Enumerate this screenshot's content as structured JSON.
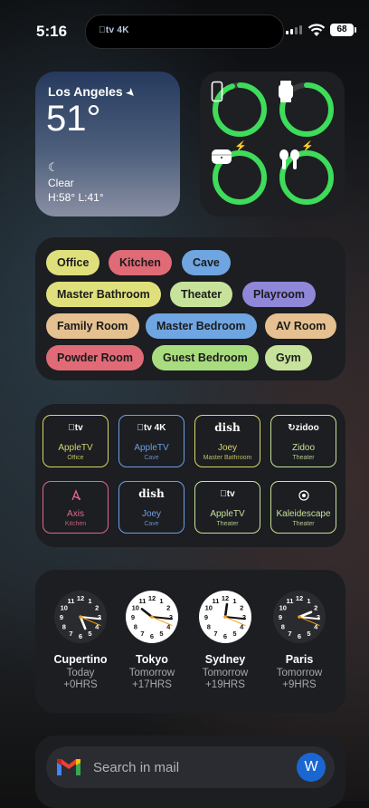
{
  "status_bar": {
    "time": "5:16",
    "island_app": "tv 4K",
    "battery": "68"
  },
  "weather": {
    "city": "Los Angeles",
    "temp": "51°",
    "condition": "Clear",
    "hilo": "H:58° L:41°",
    "icon": "moon-icon"
  },
  "batteries": [
    {
      "device": "phone-icon",
      "level": 0.95,
      "charging": false
    },
    {
      "device": "watch-icon",
      "level": 0.85,
      "charging": false
    },
    {
      "device": "airpods-case-icon",
      "level": 1.0,
      "charging": true
    },
    {
      "device": "airpods-icon",
      "level": 1.0,
      "charging": true
    }
  ],
  "rooms": {
    "r1": [
      {
        "label": "Office",
        "color": "#dfe07b"
      },
      {
        "label": "Kitchen",
        "color": "#e06a76"
      },
      {
        "label": "Cave",
        "color": "#6fa5e0"
      }
    ],
    "r2": [
      {
        "label": "Master Bathroom",
        "color": "#dfe07b"
      },
      {
        "label": "Theater",
        "color": "#c7e29a"
      },
      {
        "label": "Playroom",
        "color": "#8f87d8"
      }
    ],
    "r3": [
      {
        "label": "Family Room",
        "color": "#e5c090"
      },
      {
        "label": "Master Bedroom",
        "color": "#6fa5e0"
      },
      {
        "label": "AV Room",
        "color": "#e5c090"
      }
    ],
    "r4": [
      {
        "label": "Powder Room",
        "color": "#e06a76"
      },
      {
        "label": "Guest Bedroom",
        "color": "#a8dc7f"
      },
      {
        "label": "Gym",
        "color": "#c7e29a"
      }
    ]
  },
  "devices": [
    {
      "brand": "tv",
      "name": "AppleTV",
      "room": "Office",
      "color": "#d9d66a"
    },
    {
      "brand": "tv 4K",
      "name": "AppleTV",
      "room": "Cave",
      "color": "#6f9fe0"
    },
    {
      "brand": "dish",
      "name": "Joey",
      "room": "Master Bathroom",
      "color": "#d9d66a"
    },
    {
      "brand": "zidoo",
      "name": "Zidoo",
      "room": "Theater",
      "color": "#c7e29a"
    },
    {
      "brand": "axis",
      "name": "Axis",
      "room": "Kitchen",
      "color": "#e06a8a"
    },
    {
      "brand": "dish",
      "name": "Joey",
      "room": "Cave",
      "color": "#6f9fe0"
    },
    {
      "brand": "tv",
      "name": "AppleTV",
      "room": "Theater",
      "color": "#c7e29a"
    },
    {
      "brand": "kaleidescape",
      "name": "Kaleidescape",
      "room": "Theater",
      "color": "#c7e29a"
    }
  ],
  "clocks": [
    {
      "city": "Cupertino",
      "day": "Today",
      "offset": "+0HRS",
      "hour": 5,
      "minute": 16,
      "theme": "dark"
    },
    {
      "city": "Tokyo",
      "day": "Tomorrow",
      "offset": "+17HRS",
      "hour": 10,
      "minute": 16,
      "theme": "light"
    },
    {
      "city": "Sydney",
      "day": "Tomorrow",
      "offset": "+19HRS",
      "hour": 12,
      "minute": 16,
      "theme": "light"
    },
    {
      "city": "Paris",
      "day": "Tomorrow",
      "offset": "+9HRS",
      "hour": 2,
      "minute": 16,
      "theme": "dark"
    }
  ],
  "mail": {
    "placeholder": "Search in mail",
    "avatar": "W"
  }
}
